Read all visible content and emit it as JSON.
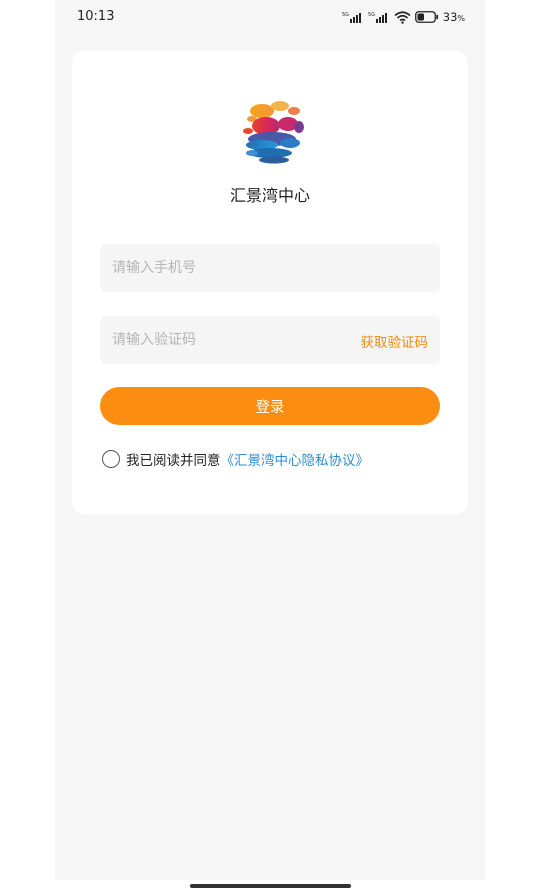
{
  "status_bar": {
    "time": "10:13",
    "signal_label": "5G",
    "battery_percent": "33",
    "battery_unit": "%"
  },
  "app": {
    "name": "汇景湾中心"
  },
  "login_form": {
    "phone_placeholder": "请输入手机号",
    "code_placeholder": "请输入验证码",
    "get_code_label": "获取验证码",
    "login_label": "登录"
  },
  "agreement": {
    "text": "我已阅读并同意",
    "link_text": "《汇景湾中心隐私协议》",
    "checked": false
  },
  "colors": {
    "accent": "#fb8d12",
    "link": "#2b8cd6",
    "background": "#f6f6f6"
  }
}
